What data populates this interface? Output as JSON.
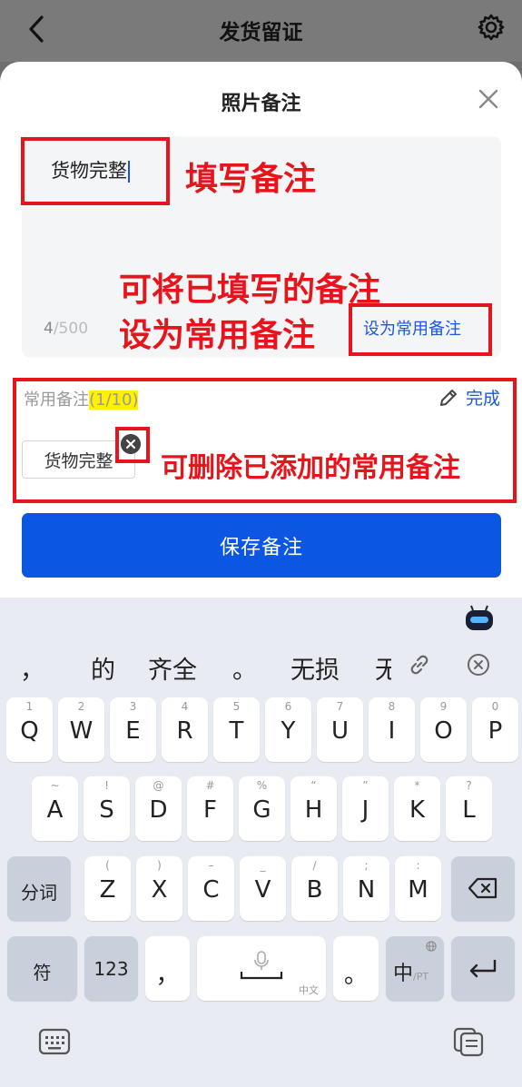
{
  "appbar": {
    "title": "发货留证"
  },
  "sheet": {
    "title": "照片备注",
    "note_text": "货物完整",
    "counter_current": "4",
    "counter_max": "/500",
    "set_common_label": "设为常用备注",
    "common_label": "常用备注",
    "common_count": "(1/10)",
    "done_label": "完成",
    "chip_label": "货物完整",
    "save_label": "保存备注"
  },
  "annotations": {
    "fill_note": "填写备注",
    "set_common_line1": "可将已填写的备注",
    "set_common_line2": "设为常用备注",
    "delete_common": "可删除已添加的常用备注",
    "color": "#e8141c"
  },
  "keyboard": {
    "candidates": [
      "，",
      "的",
      "齐全",
      "。",
      "无损",
      "无"
    ],
    "row1": [
      {
        "k": "Q",
        "h": "1"
      },
      {
        "k": "W",
        "h": "2"
      },
      {
        "k": "E",
        "h": "3"
      },
      {
        "k": "R",
        "h": "4"
      },
      {
        "k": "T",
        "h": "5"
      },
      {
        "k": "Y",
        "h": "6"
      },
      {
        "k": "U",
        "h": "7"
      },
      {
        "k": "I",
        "h": "8"
      },
      {
        "k": "O",
        "h": "9"
      },
      {
        "k": "P",
        "h": "0"
      }
    ],
    "row2": [
      {
        "k": "A",
        "h": "~"
      },
      {
        "k": "S",
        "h": "!"
      },
      {
        "k": "D",
        "h": "@"
      },
      {
        "k": "F",
        "h": "#"
      },
      {
        "k": "G",
        "h": "%"
      },
      {
        "k": "H",
        "h": "“"
      },
      {
        "k": "J",
        "h": "”"
      },
      {
        "k": "K",
        "h": "*"
      },
      {
        "k": "L",
        "h": "?"
      }
    ],
    "row3": [
      {
        "k": "Z",
        "h": "("
      },
      {
        "k": "X",
        "h": ")"
      },
      {
        "k": "C",
        "h": "–"
      },
      {
        "k": "V",
        "h": "_"
      },
      {
        "k": "B",
        "h": "/"
      },
      {
        "k": "N",
        "h": ";"
      },
      {
        "k": "M",
        "h": ":"
      }
    ],
    "fenci": "分词",
    "fu": "符",
    "num": "123",
    "comma": "，",
    "space_hint": "中文",
    "period": "。",
    "zh": "中",
    "zh_sub": "/PT"
  },
  "colors": {
    "accent": "#0b56e3",
    "link": "#1a56e8",
    "highlight": "#fff100"
  }
}
